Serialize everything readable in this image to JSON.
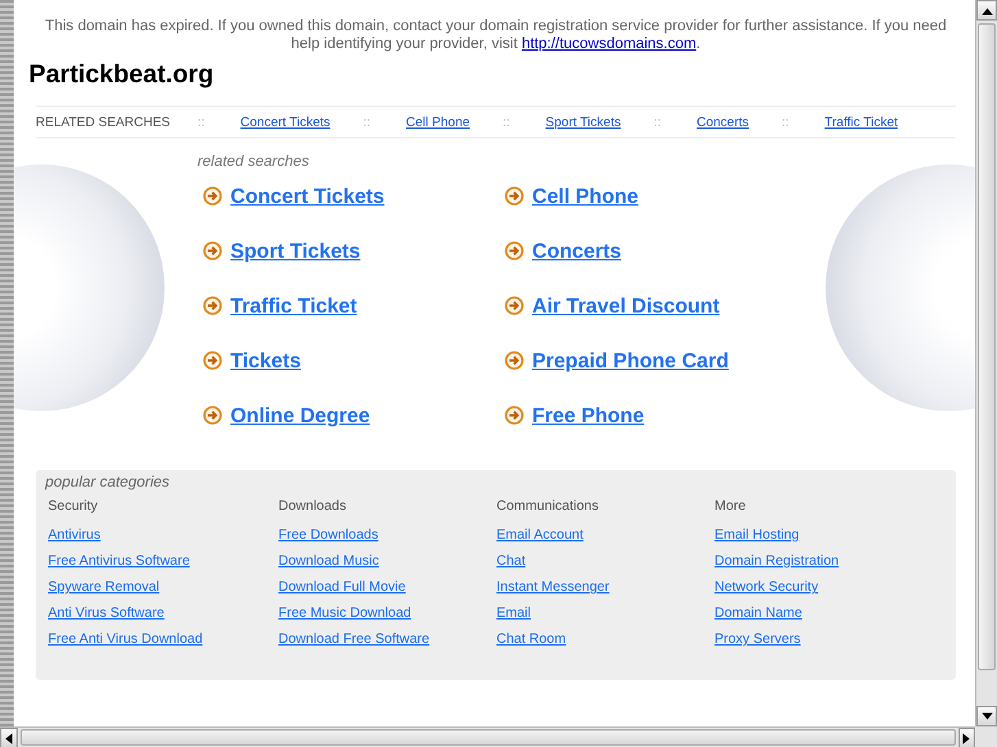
{
  "notice": {
    "text": "This domain has expired. If you owned this domain, contact your domain registration service provider for further assistance. If you need help identifying your provider, visit",
    "link": "http://tucowsdomains.com",
    "end": "."
  },
  "site_title": "Partickbeat.org",
  "related_bar": {
    "label": "RELATED SEARCHES",
    "separator": "::",
    "links": [
      "Concert Tickets",
      "Cell Phone",
      "Sport Tickets",
      "Concerts",
      "Traffic Ticket"
    ]
  },
  "related_searches": {
    "heading": "related searches",
    "links": [
      "Concert Tickets",
      "Cell Phone",
      "Sport Tickets",
      "Concerts",
      "Traffic Ticket",
      "Air Travel Discount",
      "Tickets",
      "Prepaid Phone Card",
      "Online Degree",
      "Free Phone"
    ]
  },
  "popular_categories": {
    "heading": "popular categories",
    "columns": [
      {
        "title": "Security",
        "links": [
          "Antivirus",
          "Free Antivirus Software",
          "Spyware Removal",
          "Anti Virus Software",
          "Free Anti Virus Download"
        ]
      },
      {
        "title": "Downloads",
        "links": [
          "Free Downloads",
          "Download Music",
          "Download Full Movie",
          "Free Music Download",
          "Download Free Software"
        ]
      },
      {
        "title": "Communications",
        "links": [
          "Email Account",
          "Chat",
          "Instant Messenger",
          "Email",
          "Chat Room"
        ]
      },
      {
        "title": "More",
        "links": [
          "Email Hosting",
          "Domain Registration",
          "Network Security",
          "Domain Name",
          "Proxy Servers"
        ]
      }
    ]
  }
}
